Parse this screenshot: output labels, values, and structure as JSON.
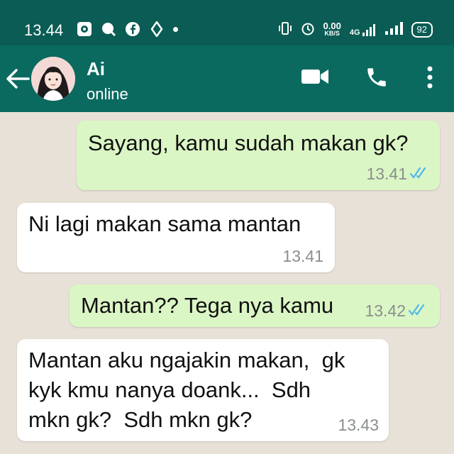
{
  "status_bar": {
    "time": "13.44",
    "net_speed_value": "0.00",
    "net_speed_unit": "KB/S",
    "network": "4G",
    "battery": "92"
  },
  "header": {
    "contact_name": "Ai",
    "contact_status": "online",
    "icons": [
      "back-arrow-icon",
      "video-call-icon",
      "phone-icon",
      "more-options-icon"
    ]
  },
  "messages": [
    {
      "direction": "outgoing",
      "text": "Sayang, kamu sudah makan gk?",
      "time": "13.41",
      "status": "read"
    },
    {
      "direction": "incoming",
      "text": "Ni lagi makan sama mantan",
      "time": "13.41"
    },
    {
      "direction": "outgoing",
      "text": "Mantan?? Tega nya kamu",
      "time": "13.42",
      "status": "read"
    },
    {
      "direction": "incoming",
      "text_lines": [
        "Mantan aku ngajakin makan,  gk",
        "kyk kmu nanya doank...  Sdh",
        "mkn gk?  Sdh mkn gk?"
      ],
      "time": "13.43"
    }
  ],
  "colors": {
    "status_bar": "#0a5c54",
    "app_bar": "#0b6a60",
    "chat_background": "#e7e1d8",
    "outgoing_bubble": "#dbf6c5",
    "incoming_bubble": "#ffffff",
    "read_ticks": "#4fb6ec"
  }
}
